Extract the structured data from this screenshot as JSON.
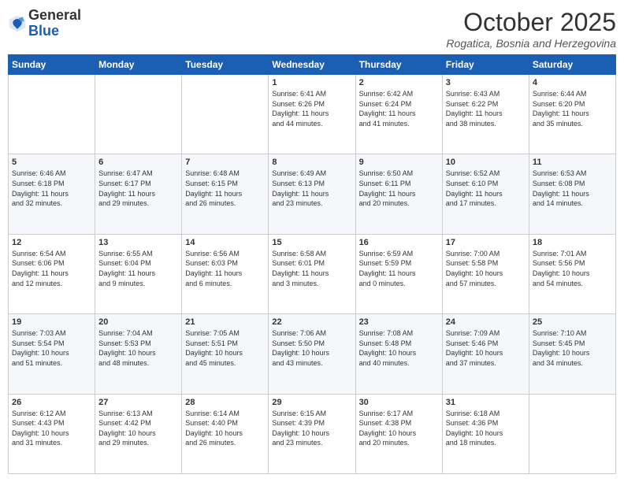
{
  "header": {
    "logo_general": "General",
    "logo_blue": "Blue",
    "month_title": "October 2025",
    "location": "Rogatica, Bosnia and Herzegovina"
  },
  "weekdays": [
    "Sunday",
    "Monday",
    "Tuesday",
    "Wednesday",
    "Thursday",
    "Friday",
    "Saturday"
  ],
  "weeks": [
    [
      {
        "day": "",
        "info": ""
      },
      {
        "day": "",
        "info": ""
      },
      {
        "day": "",
        "info": ""
      },
      {
        "day": "1",
        "info": "Sunrise: 6:41 AM\nSunset: 6:26 PM\nDaylight: 11 hours\nand 44 minutes."
      },
      {
        "day": "2",
        "info": "Sunrise: 6:42 AM\nSunset: 6:24 PM\nDaylight: 11 hours\nand 41 minutes."
      },
      {
        "day": "3",
        "info": "Sunrise: 6:43 AM\nSunset: 6:22 PM\nDaylight: 11 hours\nand 38 minutes."
      },
      {
        "day": "4",
        "info": "Sunrise: 6:44 AM\nSunset: 6:20 PM\nDaylight: 11 hours\nand 35 minutes."
      }
    ],
    [
      {
        "day": "5",
        "info": "Sunrise: 6:46 AM\nSunset: 6:18 PM\nDaylight: 11 hours\nand 32 minutes."
      },
      {
        "day": "6",
        "info": "Sunrise: 6:47 AM\nSunset: 6:17 PM\nDaylight: 11 hours\nand 29 minutes."
      },
      {
        "day": "7",
        "info": "Sunrise: 6:48 AM\nSunset: 6:15 PM\nDaylight: 11 hours\nand 26 minutes."
      },
      {
        "day": "8",
        "info": "Sunrise: 6:49 AM\nSunset: 6:13 PM\nDaylight: 11 hours\nand 23 minutes."
      },
      {
        "day": "9",
        "info": "Sunrise: 6:50 AM\nSunset: 6:11 PM\nDaylight: 11 hours\nand 20 minutes."
      },
      {
        "day": "10",
        "info": "Sunrise: 6:52 AM\nSunset: 6:10 PM\nDaylight: 11 hours\nand 17 minutes."
      },
      {
        "day": "11",
        "info": "Sunrise: 6:53 AM\nSunset: 6:08 PM\nDaylight: 11 hours\nand 14 minutes."
      }
    ],
    [
      {
        "day": "12",
        "info": "Sunrise: 6:54 AM\nSunset: 6:06 PM\nDaylight: 11 hours\nand 12 minutes."
      },
      {
        "day": "13",
        "info": "Sunrise: 6:55 AM\nSunset: 6:04 PM\nDaylight: 11 hours\nand 9 minutes."
      },
      {
        "day": "14",
        "info": "Sunrise: 6:56 AM\nSunset: 6:03 PM\nDaylight: 11 hours\nand 6 minutes."
      },
      {
        "day": "15",
        "info": "Sunrise: 6:58 AM\nSunset: 6:01 PM\nDaylight: 11 hours\nand 3 minutes."
      },
      {
        "day": "16",
        "info": "Sunrise: 6:59 AM\nSunset: 5:59 PM\nDaylight: 11 hours\nand 0 minutes."
      },
      {
        "day": "17",
        "info": "Sunrise: 7:00 AM\nSunset: 5:58 PM\nDaylight: 10 hours\nand 57 minutes."
      },
      {
        "day": "18",
        "info": "Sunrise: 7:01 AM\nSunset: 5:56 PM\nDaylight: 10 hours\nand 54 minutes."
      }
    ],
    [
      {
        "day": "19",
        "info": "Sunrise: 7:03 AM\nSunset: 5:54 PM\nDaylight: 10 hours\nand 51 minutes."
      },
      {
        "day": "20",
        "info": "Sunrise: 7:04 AM\nSunset: 5:53 PM\nDaylight: 10 hours\nand 48 minutes."
      },
      {
        "day": "21",
        "info": "Sunrise: 7:05 AM\nSunset: 5:51 PM\nDaylight: 10 hours\nand 45 minutes."
      },
      {
        "day": "22",
        "info": "Sunrise: 7:06 AM\nSunset: 5:50 PM\nDaylight: 10 hours\nand 43 minutes."
      },
      {
        "day": "23",
        "info": "Sunrise: 7:08 AM\nSunset: 5:48 PM\nDaylight: 10 hours\nand 40 minutes."
      },
      {
        "day": "24",
        "info": "Sunrise: 7:09 AM\nSunset: 5:46 PM\nDaylight: 10 hours\nand 37 minutes."
      },
      {
        "day": "25",
        "info": "Sunrise: 7:10 AM\nSunset: 5:45 PM\nDaylight: 10 hours\nand 34 minutes."
      }
    ],
    [
      {
        "day": "26",
        "info": "Sunrise: 6:12 AM\nSunset: 4:43 PM\nDaylight: 10 hours\nand 31 minutes."
      },
      {
        "day": "27",
        "info": "Sunrise: 6:13 AM\nSunset: 4:42 PM\nDaylight: 10 hours\nand 29 minutes."
      },
      {
        "day": "28",
        "info": "Sunrise: 6:14 AM\nSunset: 4:40 PM\nDaylight: 10 hours\nand 26 minutes."
      },
      {
        "day": "29",
        "info": "Sunrise: 6:15 AM\nSunset: 4:39 PM\nDaylight: 10 hours\nand 23 minutes."
      },
      {
        "day": "30",
        "info": "Sunrise: 6:17 AM\nSunset: 4:38 PM\nDaylight: 10 hours\nand 20 minutes."
      },
      {
        "day": "31",
        "info": "Sunrise: 6:18 AM\nSunset: 4:36 PM\nDaylight: 10 hours\nand 18 minutes."
      },
      {
        "day": "",
        "info": ""
      }
    ]
  ]
}
